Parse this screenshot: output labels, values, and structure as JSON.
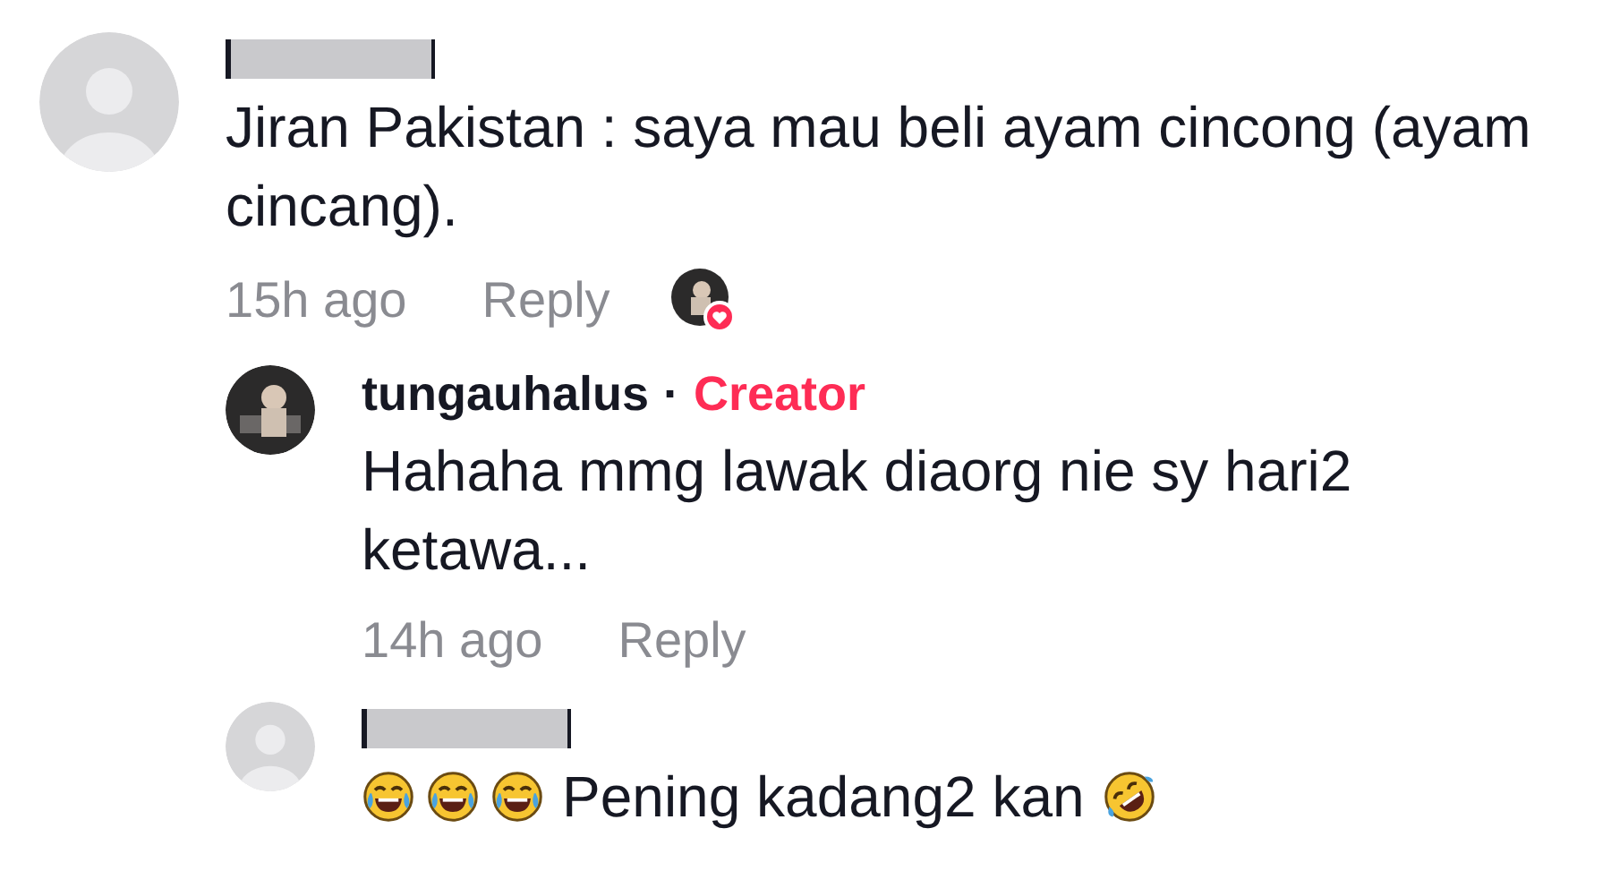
{
  "comments": [
    {
      "author": {
        "redacted": true
      },
      "avatar": {
        "kind": "default"
      },
      "body": [
        {
          "kind": "text",
          "text": "Jiran Pakistan : saya mau beli ayam cincong (ayam cincang)."
        }
      ],
      "time": "15h ago",
      "reply": "Reply",
      "liked_by_creator": true,
      "children": [
        {
          "author": {
            "name": "tungauhalus",
            "separator": "·",
            "badge": "Creator"
          },
          "avatar": {
            "kind": "photo"
          },
          "body": [
            {
              "kind": "text",
              "text": "Hahaha mmg lawak diaorg nie sy hari2 ketawa..."
            }
          ],
          "time": "14h ago",
          "reply": "Reply"
        },
        {
          "author": {
            "redacted": true
          },
          "avatar": {
            "kind": "default"
          },
          "body": [
            {
              "kind": "tears-of-joy"
            },
            {
              "kind": "tears-of-joy"
            },
            {
              "kind": "tears-of-joy"
            },
            {
              "kind": "text",
              "text": "Pening kadang2 kan"
            },
            {
              "kind": "rolling-laughing"
            }
          ]
        }
      ]
    }
  ]
}
